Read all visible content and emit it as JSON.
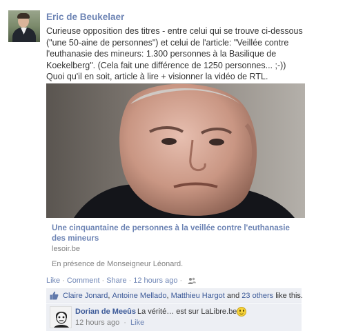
{
  "post": {
    "author": "Eric de Beukelaer",
    "message_lines": [
      "Curieuse opposition des titres - entre celui qui se trouve ci-dessous",
      "(\"une 50-aine de personnes\") et celui de l'article: \"Veillée contre",
      "l'euthanasie des mineurs: 1.300 personnes à la Basilique de",
      "Koekelberg\". (Cela fait une différence de 1250 personnes... ;-))",
      "Quoi qu'il en soit, article à lire + visionner la vidéo de RTL."
    ]
  },
  "shared_link": {
    "title": "Une cinquantaine de personnes à la veillée contre l'euthanasie des mineurs",
    "domain": "lesoir.be",
    "caption": "En présence de Monseigneur Léonard."
  },
  "actions": {
    "like": "Like",
    "comment": "Comment",
    "share": "Share",
    "separator": "·",
    "timestamp": "12 hours ago",
    "audience_icon": "friends-icon"
  },
  "likes": {
    "icon": "thumbs-up-icon",
    "names": [
      "Claire Jonard",
      "Antoine Mellado",
      "Matthieu Hargot"
    ],
    "comma": ", ",
    "and": " and ",
    "others": "23 others",
    "suffix": " like this."
  },
  "comment": {
    "author": "Dorian de Meeûs",
    "text": "La vérité… est sur LaLibre.be.",
    "emoticon": "smiley-icon",
    "timestamp": "12 hours ago",
    "like": "Like",
    "separator": "·"
  },
  "colors": {
    "link": "#3b5998",
    "ufi_background": "#edeff4",
    "meta_text": "#808080"
  }
}
